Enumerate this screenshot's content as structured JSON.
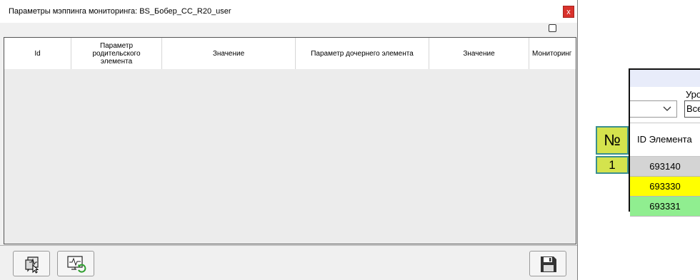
{
  "dialog": {
    "title": "Параметры мэппинга мониторинга: BS_Бобер_CC_R20_user",
    "close_label": "x",
    "columns": [
      "Id",
      "Параметр родительского элемента",
      "Значение",
      "Параметр дочернего элемента",
      "Значение",
      "Мониторинг"
    ],
    "toolbar_icons": [
      "monitor-cursor-icon",
      "monitor-refresh-icon",
      "save-icon"
    ]
  },
  "panel": {
    "label": "Уро",
    "select_value": "Все",
    "id_header": "ID Элемента",
    "number_header": "№",
    "row_number": "1",
    "rows": [
      {
        "id": "693140",
        "color": "#d4d4d4"
      },
      {
        "id": "693330",
        "color": "#ffff00"
      },
      {
        "id": "693331",
        "color": "#90ee90"
      }
    ]
  }
}
